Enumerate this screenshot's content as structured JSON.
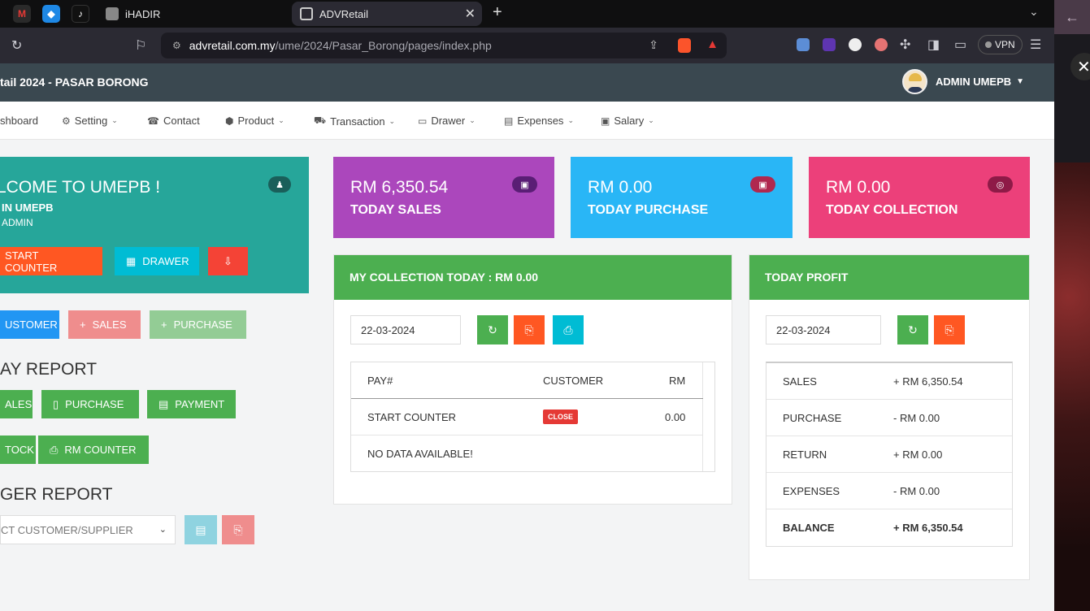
{
  "browser": {
    "tabs": [
      {
        "label": "iHADIR"
      },
      {
        "label": "ADVRetail"
      }
    ],
    "url_host": "advretail.com.my",
    "url_path": "/ume/2024/Pasar_Borong/pages/index.php",
    "vpn_label": "VPN"
  },
  "header": {
    "app_title": "tail 2024 - PASAR BORONG",
    "user_name": "ADMIN UMEPB"
  },
  "nav": {
    "items": [
      {
        "label": "shboard",
        "icon": "dashboard-icon"
      },
      {
        "label": "Setting",
        "icon": "gears-icon"
      },
      {
        "label": "Contact",
        "icon": "phone-icon"
      },
      {
        "label": "Product",
        "icon": "cube-icon"
      },
      {
        "label": "Transaction",
        "icon": "cart-icon"
      },
      {
        "label": "Drawer",
        "icon": "laptop-icon"
      },
      {
        "label": "Expenses",
        "icon": "credit-card-icon"
      },
      {
        "label": "Salary",
        "icon": "money-icon"
      }
    ]
  },
  "welcome": {
    "title": "LCOME TO UMEPB !",
    "line1": "IN UMEPB",
    "line2": "ADMIN",
    "btn_start_counter": "START COUNTER",
    "btn_drawer": "DRAWER"
  },
  "quick": {
    "customer": "USTOMER",
    "sales": "SALES",
    "purchase": "PURCHASE"
  },
  "day_report": {
    "title": "AY REPORT",
    "sales": "ALES",
    "purchase": "PURCHASE",
    "payment": "PAYMENT",
    "stock": "TOCK",
    "rm_counter": "RM COUNTER"
  },
  "ledger_report": {
    "title": "GER REPORT",
    "select_placeholder": "CT CUSTOMER/SUPPLIER"
  },
  "stats": [
    {
      "amount": "RM 6,350.54",
      "label": "TODAY SALES",
      "color": "#ab47bc"
    },
    {
      "amount": "RM 0.00",
      "label": "TODAY PURCHASE",
      "color": "#29b6f6"
    },
    {
      "amount": "RM 0.00",
      "label": "TODAY COLLECTION",
      "color": "#ec407a"
    }
  ],
  "collection": {
    "title": "MY COLLECTION TODAY : RM 0.00",
    "date": "22-03-2024",
    "col_pay": "PAY#",
    "col_customer": "CUSTOMER",
    "col_rm": "RM",
    "row1_pay": "START COUNTER",
    "row1_status": "CLOSE",
    "row1_rm": "0.00",
    "empty": "NO DATA AVAILABLE!"
  },
  "profit": {
    "title": "TODAY PROFIT",
    "date": "22-03-2024",
    "rows": [
      {
        "label": "SALES",
        "value": "+ RM 6,350.54"
      },
      {
        "label": "PURCHASE",
        "value": "- RM 0.00"
      },
      {
        "label": "RETURN",
        "value": "+ RM 0.00"
      },
      {
        "label": "EXPENSES",
        "value": "- RM 0.00"
      },
      {
        "label": "BALANCE",
        "value": "+ RM 6,350.54"
      }
    ]
  },
  "colors": {
    "teal": "#26a69a",
    "green": "#4caf50",
    "orange": "#ff5722",
    "cyan": "#00bcd4",
    "red": "#f44336",
    "blue": "#2196f3"
  }
}
